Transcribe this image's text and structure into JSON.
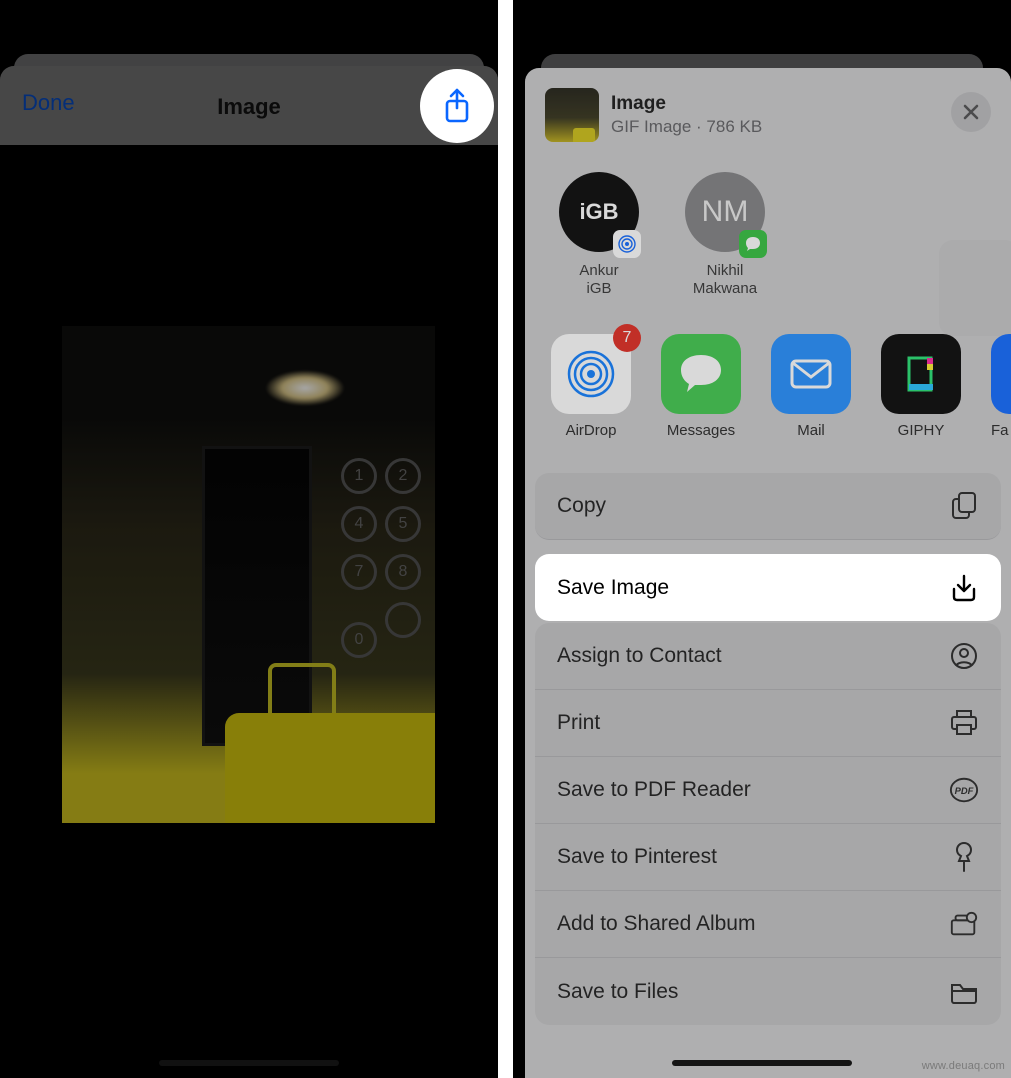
{
  "left": {
    "done_label": "Done",
    "title": "Image"
  },
  "right": {
    "header": {
      "title": "Image",
      "subtitle": "GIF Image · 786 KB"
    },
    "contacts": [
      {
        "initials": "iGB",
        "name_line1": "Ankur",
        "name_line2": "iGB",
        "badge": "airdrop"
      },
      {
        "initials": "NM",
        "name_line1": "Nikhil",
        "name_line2": "Makwana",
        "badge": "messages"
      }
    ],
    "apps": [
      {
        "label": "AirDrop",
        "badge": "7"
      },
      {
        "label": "Messages"
      },
      {
        "label": "Mail"
      },
      {
        "label": "GIPHY"
      },
      {
        "label": "Fa"
      }
    ],
    "actions": {
      "copy": "Copy",
      "save_image": "Save Image",
      "assign_contact": "Assign to Contact",
      "print": "Print",
      "save_pdf": "Save to PDF Reader",
      "save_pinterest": "Save to Pinterest",
      "add_shared": "Add to Shared Album",
      "save_files": "Save to Files"
    }
  },
  "watermark": "www.deuaq.com"
}
